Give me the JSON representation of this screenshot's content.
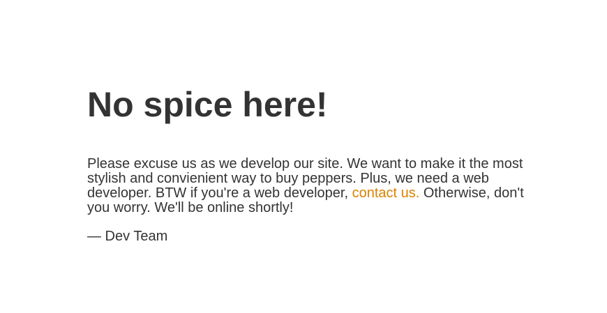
{
  "heading": "No spice here!",
  "message": {
    "before_link": "Please excuse us as we develop our site. We want to make it the most stylish and convienient way to buy peppers. Plus, we need a web developer. BTW if you're a web developer, ",
    "link_text": "contact us.",
    "after_link": " Otherwise, don't you worry. We'll be online shortly!"
  },
  "signature": "— Dev Team",
  "colors": {
    "text": "#333333",
    "link": "#dc8100",
    "background": "#ffffff"
  }
}
